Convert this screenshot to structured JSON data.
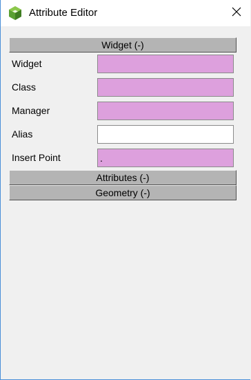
{
  "window": {
    "title": "Attribute Editor",
    "close_glyph": "✕",
    "app_icon": "cube-icon",
    "border_color": "#4a8fd8"
  },
  "sections": {
    "widget": {
      "label": "Widget (-)"
    },
    "attributes": {
      "label": "Attributes (-)"
    },
    "geometry": {
      "label": "Geometry (-)"
    }
  },
  "fields": {
    "widget": {
      "label": "Widget",
      "value": ""
    },
    "class": {
      "label": "Class",
      "value": ""
    },
    "manager": {
      "label": "Manager",
      "value": ""
    },
    "alias": {
      "label": "Alias",
      "value": ""
    },
    "insert_point": {
      "label": "Insert Point",
      "value": "."
    }
  },
  "colors": {
    "field_highlight": "#dda0dd",
    "field_normal": "#ffffff",
    "section_header_bg": "#b4b4b4",
    "background": "#f0f0f0",
    "icon_green": "#5aa032"
  }
}
